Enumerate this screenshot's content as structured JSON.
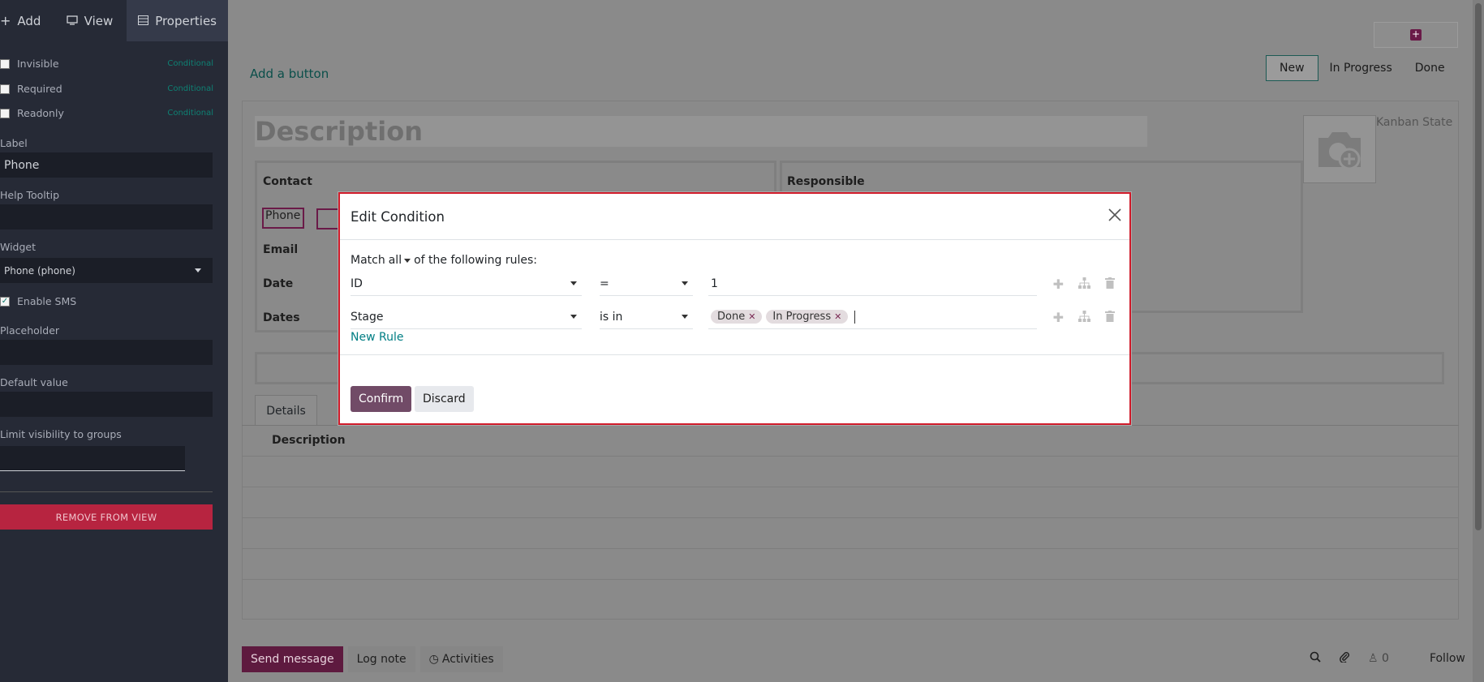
{
  "sidebar": {
    "tabs": {
      "add": "Add",
      "view": "View",
      "properties": "Properties"
    },
    "checkboxes": [
      {
        "label": "Invisible",
        "checked": false,
        "conditional": "Conditional"
      },
      {
        "label": "Required",
        "checked": false,
        "conditional": "Conditional"
      },
      {
        "label": "Readonly",
        "checked": false,
        "conditional": "Conditional"
      }
    ],
    "label_title": "Label",
    "label_value": "Phone",
    "help_tooltip_title": "Help Tooltip",
    "widget_title": "Widget",
    "widget_value": "Phone (phone)",
    "enable_sms": "Enable SMS",
    "placeholder_title": "Placeholder",
    "default_value_title": "Default value",
    "limit_visibility_title": "Limit visibility to groups",
    "remove_button": "REMOVE FROM VIEW"
  },
  "form": {
    "add_button": "Add a button",
    "stages": [
      "New",
      "In Progress",
      "Done"
    ],
    "active_stage": "New",
    "description_placeholder": "Description",
    "kanban_state": "Kanban State",
    "fields_left": [
      "Contact",
      "Phone",
      "Email",
      "Date",
      "Dates"
    ],
    "fields_right": [
      "Responsible"
    ],
    "tab_details": "Details",
    "table_header": "Description"
  },
  "chatter": {
    "send_message": "Send message",
    "log_note": "Log note",
    "activities": "Activities",
    "followers_count": "0",
    "follow": "Follow"
  },
  "modal": {
    "title": "Edit Condition",
    "match_prefix": "Match",
    "match_mode": "all",
    "match_suffix": "of the following rules:",
    "rules": [
      {
        "field": "ID",
        "operator": "=",
        "value": "1"
      },
      {
        "field": "Stage",
        "operator": "is in",
        "tags": [
          "Done",
          "In Progress"
        ]
      }
    ],
    "new_rule": "New Rule",
    "confirm": "Confirm",
    "discard": "Discard"
  }
}
